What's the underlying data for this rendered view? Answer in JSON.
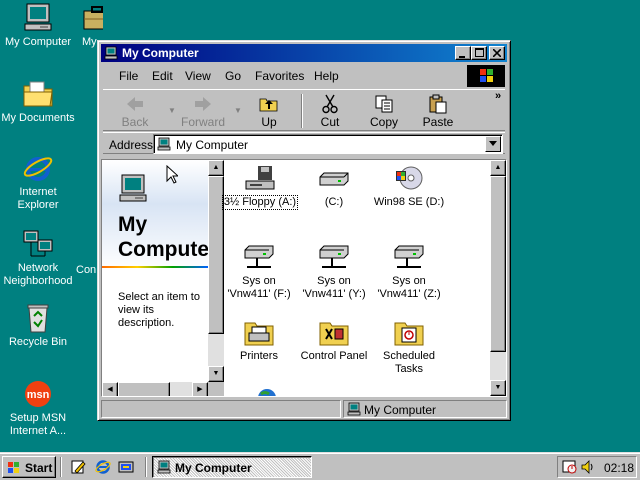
{
  "desktop": {
    "icons": [
      {
        "label": "My Computer"
      },
      {
        "label": "My Documents"
      },
      {
        "label": "Internet Explorer"
      },
      {
        "label": "Network Neighborhood"
      },
      {
        "label": "Recycle Bin"
      },
      {
        "label": "Setup MSN Internet A..."
      }
    ],
    "partial_labels": [
      "My",
      "Con"
    ]
  },
  "window": {
    "title": "My Computer",
    "menu": [
      "File",
      "Edit",
      "View",
      "Go",
      "Favorites",
      "Help"
    ],
    "toolbar": [
      {
        "label": "Back",
        "icon": "back-arrow-icon",
        "enabled": false
      },
      {
        "label": "Forward",
        "icon": "forward-arrow-icon",
        "enabled": false
      },
      {
        "label": "Up",
        "icon": "up-folder-icon",
        "enabled": true
      },
      {
        "label": "Cut",
        "icon": "scissors-icon",
        "enabled": true
      },
      {
        "label": "Copy",
        "icon": "copy-icon",
        "enabled": true
      },
      {
        "label": "Paste",
        "icon": "paste-icon",
        "enabled": true
      }
    ],
    "toolbar_more": "»",
    "address": {
      "label": "Address",
      "value": "My Computer"
    },
    "left_pane": {
      "title": "My Computer",
      "description": "Select an item to view its description."
    },
    "items": [
      {
        "label": "3½ Floppy (A:)",
        "icon": "floppy-drive-icon",
        "selected": true
      },
      {
        "label": "(C:)",
        "icon": "hard-drive-icon"
      },
      {
        "label": "Win98 SE (D:)",
        "icon": "cd-drive-icon"
      },
      {
        "label": "Sys on 'Vnw411' (F:)",
        "icon": "network-drive-icon"
      },
      {
        "label": "Sys on 'Vnw411' (Y:)",
        "icon": "network-drive-icon"
      },
      {
        "label": "Sys on 'Vnw411' (Z:)",
        "icon": "network-drive-icon"
      },
      {
        "label": "Printers",
        "icon": "printers-folder-icon"
      },
      {
        "label": "Control Panel",
        "icon": "control-panel-icon"
      },
      {
        "label": "Scheduled Tasks",
        "icon": "scheduled-tasks-icon"
      }
    ],
    "status": "My Computer"
  },
  "taskbar": {
    "start_label": "Start",
    "task_button": "My Computer",
    "clock": "02:18"
  },
  "colors": {
    "desktop": "#008080",
    "title_active": "#000080",
    "face": "#c0c0c0"
  }
}
